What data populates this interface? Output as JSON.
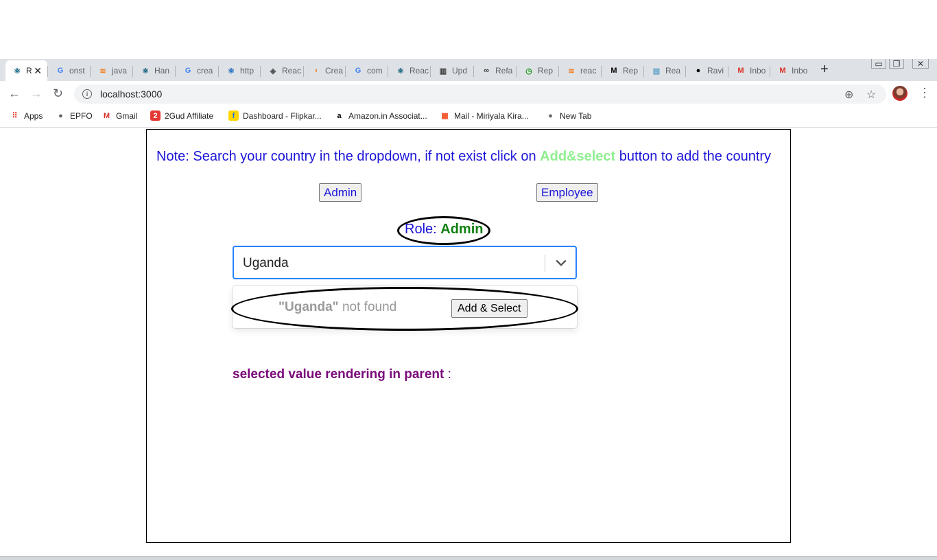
{
  "browser": {
    "tabs": [
      {
        "label": "R",
        "icon": "react-icon",
        "color": "#0e5f7a"
      },
      {
        "label": "onst",
        "icon": "google-icon",
        "color": "#4285f4"
      },
      {
        "label": "java",
        "icon": "stackoverflow-icon",
        "color": "#f48024"
      },
      {
        "label": "Han",
        "icon": "react-icon",
        "color": "#0e5f7a"
      },
      {
        "label": "crea",
        "icon": "google-icon",
        "color": "#4285f4"
      },
      {
        "label": "http",
        "icon": "codesandbox-icon",
        "color": "#1565c0"
      },
      {
        "label": "Reac",
        "icon": "diamond-icon",
        "color": "#555555"
      },
      {
        "label": "Crea",
        "icon": "create-icon",
        "color": "#ef6c00"
      },
      {
        "label": "com",
        "icon": "google-icon",
        "color": "#4285f4"
      },
      {
        "label": "Reac",
        "icon": "react-icon",
        "color": "#0e5f7a"
      },
      {
        "label": "Upd",
        "icon": "book-icon",
        "color": "#333333"
      },
      {
        "label": "Refa",
        "icon": "glasses-icon",
        "color": "#333333"
      },
      {
        "label": "Rep",
        "icon": "clock-icon",
        "color": "#1b9e1b"
      },
      {
        "label": "reac",
        "icon": "stackoverflow-icon",
        "color": "#f48024"
      },
      {
        "label": "Rep",
        "icon": "medium-icon",
        "color": "#000000"
      },
      {
        "label": "Rea",
        "icon": "image-icon",
        "color": "#5aa0c8"
      },
      {
        "label": "Ravi",
        "icon": "github-icon",
        "color": "#000000"
      },
      {
        "label": "Inbo",
        "icon": "gmail-icon",
        "color": "#d93025"
      },
      {
        "label": "Inbo",
        "icon": "gmail-icon",
        "color": "#d93025"
      }
    ],
    "new_tab": "+",
    "url": "localhost:3000",
    "bookmarks": [
      {
        "label": "Apps",
        "icon": "apps-grid-icon"
      },
      {
        "label": "EPFO",
        "icon": "globe-icon"
      },
      {
        "label": "Gmail",
        "icon": "gmail-icon"
      },
      {
        "label": "2Gud Affiliate",
        "icon": "2gud-icon"
      },
      {
        "label": "Dashboard - Flipkar...",
        "icon": "flipkart-icon"
      },
      {
        "label": "Amazon.in Associat...",
        "icon": "amazon-icon"
      },
      {
        "label": "Mail - Miriyala Kira...",
        "icon": "microsoft-icon"
      },
      {
        "label": "New Tab",
        "icon": "globe-icon"
      }
    ]
  },
  "page": {
    "note_prefix": "Note: Search your country in the dropdown, if not exist click on ",
    "note_highlight": "Add&select",
    "note_suffix": " button to add the country",
    "admin_button": "Admin",
    "employee_button": "Employee",
    "role_label": "Role: ",
    "role_value": "Admin",
    "select_value": "Uganda",
    "not_found_term": "\"Uganda\"",
    "not_found_text": " not found",
    "add_select_button": "Add & Select",
    "selected_label": "selected value rendering in parent",
    "selected_suffix": " :"
  }
}
